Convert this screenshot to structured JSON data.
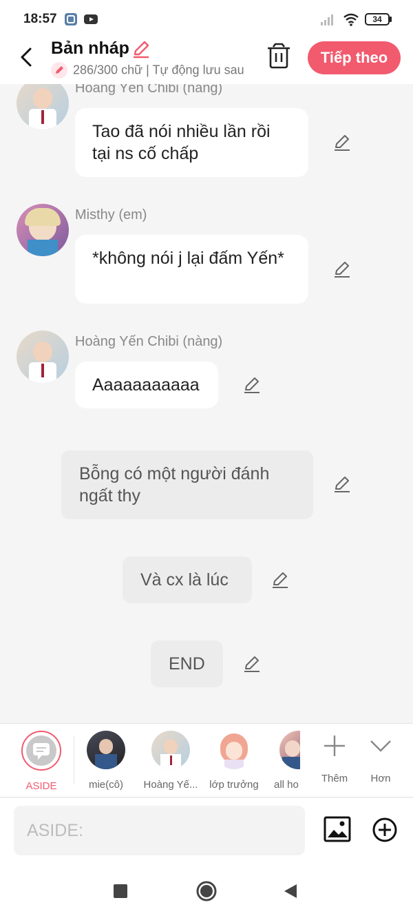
{
  "status_bar": {
    "time": "18:57",
    "battery": "34",
    "icons": [
      "gallery-icon",
      "youtube-icon",
      "signal-icon",
      "wifi-icon",
      "battery-icon"
    ]
  },
  "header": {
    "title": "Bản nháp",
    "subtitle": "286/300 chữ | Tự động lưu sau",
    "next_label": "Tiếp theo"
  },
  "messages": [
    {
      "type": "character",
      "name": "Hoàng Yến Chibi (nàng)",
      "text": "Tao đã nói nhiều lần rồi tại ns cố chấp"
    },
    {
      "type": "character",
      "name": "Misthy (em)",
      "text": "*không nói j lại đấm Yến*"
    },
    {
      "type": "character",
      "name": "Hoàng Yến Chibi (nàng)",
      "text": "Aaaaaaaaaaa"
    },
    {
      "type": "narration",
      "text": "Bỗng có một người đánh ngất thy"
    },
    {
      "type": "narration",
      "text": "Và cx là lúc"
    },
    {
      "type": "narration",
      "text": "END"
    }
  ],
  "characters": [
    {
      "name": "ASIDE",
      "selected": true
    },
    {
      "name": "mie(cô)"
    },
    {
      "name": "Hoàng Yế..."
    },
    {
      "name": "lớp trưởng"
    },
    {
      "name": "all ho"
    }
  ],
  "char_actions": {
    "add_label": "Thêm",
    "more_label": "Hơn"
  },
  "input": {
    "placeholder": "ASIDE:"
  },
  "colors": {
    "accent": "#f25a6e",
    "background": "#f5f5f5",
    "bubble": "#ffffff",
    "narration": "#ececec"
  }
}
